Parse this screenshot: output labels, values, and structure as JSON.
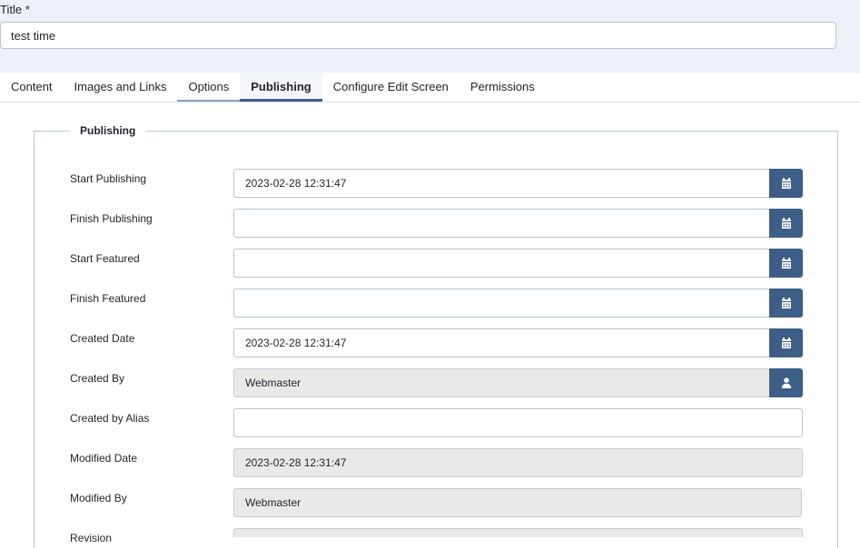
{
  "title_field": {
    "label": "Title *",
    "value": "test time"
  },
  "tabs": [
    {
      "label": "Content"
    },
    {
      "label": "Images and Links"
    },
    {
      "label": "Options"
    },
    {
      "label": "Publishing"
    },
    {
      "label": "Configure Edit Screen"
    },
    {
      "label": "Permissions"
    }
  ],
  "publishing": {
    "legend": "Publishing",
    "fields": [
      {
        "label": "Start Publishing",
        "value": "2023-02-28 12:31:47",
        "button_icon": "calendar-icon"
      },
      {
        "label": "Finish Publishing",
        "value": "",
        "button_icon": "calendar-icon"
      },
      {
        "label": "Start Featured",
        "value": "",
        "button_icon": "calendar-icon"
      },
      {
        "label": "Finish Featured",
        "value": "",
        "button_icon": "calendar-icon"
      },
      {
        "label": "Created Date",
        "value": "2023-02-28 12:31:47",
        "button_icon": "calendar-icon"
      },
      {
        "label": "Created By",
        "value": "Webmaster",
        "button_icon": "user-icon"
      },
      {
        "label": "Created by Alias",
        "value": ""
      },
      {
        "label": "Modified Date",
        "value": "2023-02-28 12:31:47"
      },
      {
        "label": "Modified By",
        "value": "Webmaster"
      },
      {
        "label": "Revision",
        "value": ""
      }
    ]
  },
  "colors": {
    "accent": "#3d5e87",
    "border": "#b8c4d2",
    "readonly_bg": "#e9e9ea",
    "top_band": "#eef2f8"
  }
}
